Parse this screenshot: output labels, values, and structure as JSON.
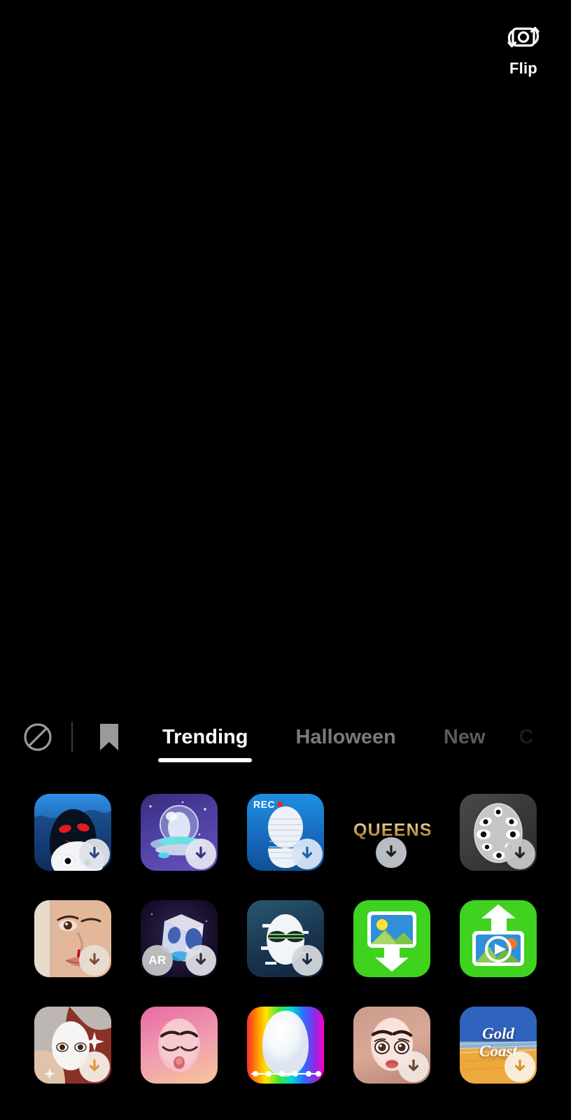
{
  "app": {
    "background_color": "#000000",
    "accent_color": "#ffffff"
  },
  "viewfinder": {
    "state_label": "camera-preview-black"
  },
  "flip": {
    "label": "Flip",
    "icon": "camera-flip-icon"
  },
  "effects_panel": {
    "left_icons": [
      {
        "name": "no-effect-icon",
        "glyph": "prohibit"
      },
      {
        "name": "bookmark-icon",
        "glyph": "bookmark"
      }
    ],
    "tabs": [
      {
        "label": "Trending",
        "active": true
      },
      {
        "label": "Halloween",
        "active": false
      },
      {
        "label": "New",
        "active": false
      },
      {
        "label": "C",
        "active": false,
        "partial": true
      }
    ],
    "grid": {
      "columns": 5,
      "rows": 3,
      "items": [
        {
          "id": "ghost-shadow",
          "name": "effect-ghost-shadow",
          "art": "ghost",
          "label": "",
          "badge": "download",
          "badge_tint": "#2d4a7a"
        },
        {
          "id": "ufo-globe",
          "name": "effect-ufo-globe",
          "art": "ufo",
          "label": "",
          "badge": "download",
          "badge_tint": "#3b2f7a"
        },
        {
          "id": "rec-ghost",
          "name": "effect-rec-ghost",
          "art": "rec",
          "label": "REC",
          "badge": "download",
          "badge_tint": "#1f5fa8"
        },
        {
          "id": "queens",
          "name": "effect-queens",
          "art": "queens",
          "label": "QUEENS",
          "badge": "download",
          "badge_tint": "#2b2b2b"
        },
        {
          "id": "many-eyes-mask",
          "name": "effect-many-eyes-mask",
          "art": "eyes",
          "label": "",
          "badge": "download",
          "badge_tint": "#333333"
        },
        {
          "id": "bloody-nose",
          "name": "effect-bloody-nose",
          "art": "blood",
          "label": "",
          "badge": "download",
          "badge_tint": "#8a5a46"
        },
        {
          "id": "ar-cube",
          "name": "effect-ar-cube",
          "art": "cube",
          "label": "AR",
          "badge": "download",
          "badge_tint": "#3a3a5a",
          "corner_badge": "AR"
        },
        {
          "id": "glitch-face",
          "name": "effect-glitch-face",
          "art": "glitch",
          "label": "",
          "badge": "download",
          "badge_tint": "#1b3550"
        },
        {
          "id": "upload-photo",
          "name": "effect-upload-photo",
          "art": "upload",
          "label": "",
          "badge": "none",
          "badge_tint": ""
        },
        {
          "id": "upload-video",
          "name": "effect-upload-video",
          "art": "video",
          "label": "",
          "badge": "none",
          "badge_tint": ""
        },
        {
          "id": "sparkle-mask",
          "name": "effect-sparkle-mask",
          "art": "sparkle",
          "label": "",
          "badge": "download",
          "badge_tint": "#c98a3c"
        },
        {
          "id": "pink-face",
          "name": "effect-pink-face",
          "art": "pink",
          "label": "",
          "badge": "none",
          "badge_tint": ""
        },
        {
          "id": "rainbow-face",
          "name": "effect-rainbow-face",
          "art": "rainbow",
          "label": "",
          "badge": "none",
          "badge_tint": ""
        },
        {
          "id": "doll-face",
          "name": "effect-doll-face",
          "art": "face",
          "label": "",
          "badge": "download",
          "badge_tint": "#6a4a3c"
        },
        {
          "id": "gold-coast",
          "name": "effect-gold-coast",
          "art": "coast",
          "label": "Gold Coast",
          "badge": "download",
          "badge_tint": "#c98a2c"
        }
      ]
    }
  }
}
